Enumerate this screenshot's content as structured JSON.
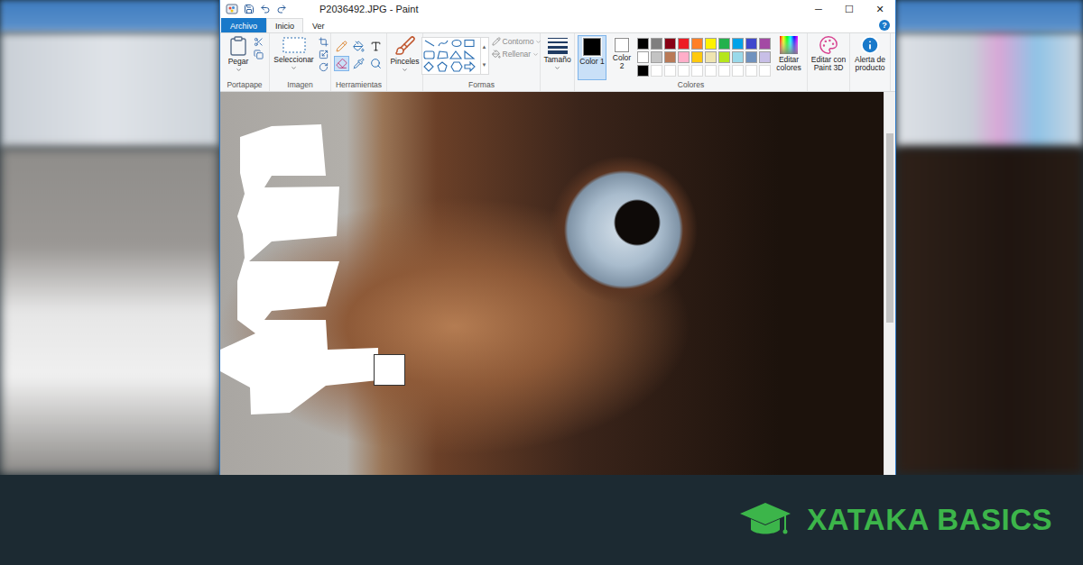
{
  "window": {
    "title": "P2036492.JPG - Paint",
    "controls": [
      {
        "label": "─"
      },
      {
        "label": "☐"
      },
      {
        "label": "✕"
      }
    ]
  },
  "menu_tabs": [
    {
      "label": "Archivo",
      "selected": false,
      "kind": "file"
    },
    {
      "label": "Inicio",
      "selected": true,
      "kind": "tab"
    },
    {
      "label": "Ver",
      "selected": false,
      "kind": "tab"
    }
  ],
  "help": "?",
  "ribbon": {
    "clipboard": {
      "paste": "Pegar",
      "label": "Portapape"
    },
    "image": {
      "select": "Seleccionar",
      "label": "Imagen"
    },
    "tools": {
      "label": "Herramientas",
      "items": [
        {
          "kind": "pencil",
          "selected": false
        },
        {
          "kind": "fill",
          "selected": false
        },
        {
          "kind": "text",
          "selected": false
        },
        {
          "kind": "eraser",
          "selected": true
        },
        {
          "kind": "picker",
          "selected": false
        },
        {
          "kind": "magnifier",
          "selected": false
        }
      ]
    },
    "brushes": {
      "label": "Pinceles"
    },
    "shapes": {
      "outline": {
        "label": "Contorno",
        "disabled": true
      },
      "fill": {
        "label": "Rellenar",
        "disabled": true
      },
      "label": "Formas"
    },
    "size": {
      "label": "Tamaño"
    },
    "color1": {
      "label": "Color 1",
      "selected": true,
      "color": "#000000"
    },
    "color2": {
      "label": "Color 2",
      "selected": false,
      "color": "#ffffff"
    },
    "palette": {
      "label": "Colores",
      "swatches": [
        {
          "color": "#000000",
          "empty": false
        },
        {
          "color": "#7f7f7f",
          "empty": false
        },
        {
          "color": "#880015",
          "empty": false
        },
        {
          "color": "#ed1c24",
          "empty": false
        },
        {
          "color": "#ff7f27",
          "empty": false
        },
        {
          "color": "#fff200",
          "empty": false
        },
        {
          "color": "#22b14c",
          "empty": false
        },
        {
          "color": "#00a2e8",
          "empty": false
        },
        {
          "color": "#3f48cc",
          "empty": false
        },
        {
          "color": "#a349a4",
          "empty": false
        },
        {
          "color": "#ffffff",
          "empty": false
        },
        {
          "color": "#c3c3c3",
          "empty": false
        },
        {
          "color": "#b97a57",
          "empty": false
        },
        {
          "color": "#ffaec9",
          "empty": false
        },
        {
          "color": "#ffc90e",
          "empty": false
        },
        {
          "color": "#efe4b0",
          "empty": false
        },
        {
          "color": "#b5e61d",
          "empty": false
        },
        {
          "color": "#99d9ea",
          "empty": false
        },
        {
          "color": "#7092be",
          "empty": false
        },
        {
          "color": "#c8bfe7",
          "empty": false
        },
        {
          "color": "#000000",
          "empty": false
        },
        {
          "color": "#ffffff",
          "empty": true
        },
        {
          "color": "#ffffff",
          "empty": true
        },
        {
          "color": "#ffffff",
          "empty": true
        },
        {
          "color": "#ffffff",
          "empty": true
        },
        {
          "color": "#ffffff",
          "empty": true
        },
        {
          "color": "#ffffff",
          "empty": true
        },
        {
          "color": "#ffffff",
          "empty": true
        },
        {
          "color": "#ffffff",
          "empty": true
        },
        {
          "color": "#ffffff",
          "empty": true
        }
      ]
    },
    "edit_colors": "Editar colores",
    "paint3d": "Editar con Paint 3D",
    "product_alert": "Alerta de producto"
  },
  "banner": {
    "brand": "XATAKA BASICS"
  }
}
